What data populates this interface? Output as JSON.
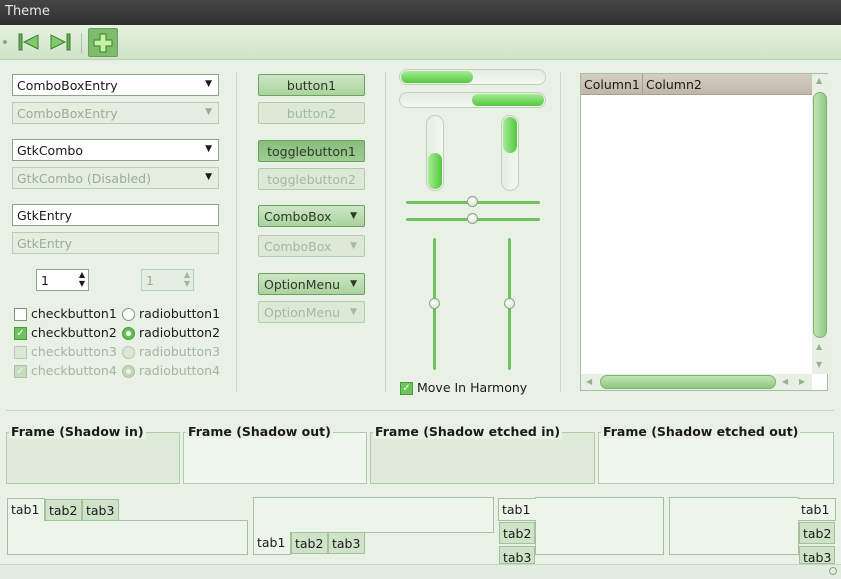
{
  "window": {
    "title": "Theme"
  },
  "toolbar": {
    "back_icon": "go-first-icon",
    "forward_icon": "go-last-icon",
    "add_icon": "add-plus-icon"
  },
  "column1": {
    "combo_entry": "ComboBoxEntry",
    "combo_entry_disabled": "ComboBoxEntry",
    "gtkcombo": "GtkCombo",
    "gtkcombo_disabled": "GtkCombo (Disabled)",
    "entry": "GtkEntry",
    "entry_disabled": "GtkEntry",
    "spin_value": "1",
    "spin_disabled_value": "1",
    "checks": [
      {
        "check_label": "checkbutton1",
        "radio_label": "radiobutton1"
      },
      {
        "check_label": "checkbutton2",
        "radio_label": "radiobutton2"
      },
      {
        "check_label": "checkbutton3",
        "radio_label": "radiobutton3"
      },
      {
        "check_label": "checkbutton4",
        "radio_label": "radiobutton4"
      }
    ]
  },
  "column2": {
    "button1": "button1",
    "button2": "button2",
    "toggle1": "togglebutton1",
    "toggle2": "togglebutton2",
    "combobox": "ComboBox",
    "combobox_disabled": "ComboBox",
    "optionmenu": "OptionMenu",
    "optionmenu_disabled": "OptionMenu"
  },
  "column3": {
    "progress_h1": 0.5,
    "progress_h2": 0.5,
    "progress_v1": 0.5,
    "progress_v2": 0.5,
    "hscale1": 0.5,
    "hscale2": 0.5,
    "vscale1": 0.5,
    "vscale2": 0.5,
    "move_in_harmony": "Move In Harmony"
  },
  "treeview": {
    "columns": [
      "Column1",
      "Column2"
    ]
  },
  "frames": [
    "Frame (Shadow in)",
    "Frame (Shadow out)",
    "Frame (Shadow etched in)",
    "Frame (Shadow etched out)"
  ],
  "notebooks": {
    "tabs": [
      "tab1",
      "tab2",
      "tab3"
    ]
  },
  "colors": {
    "accent": "#5fc04d",
    "background": "#e9f0e6",
    "titlebar": "#3a3a3a"
  }
}
